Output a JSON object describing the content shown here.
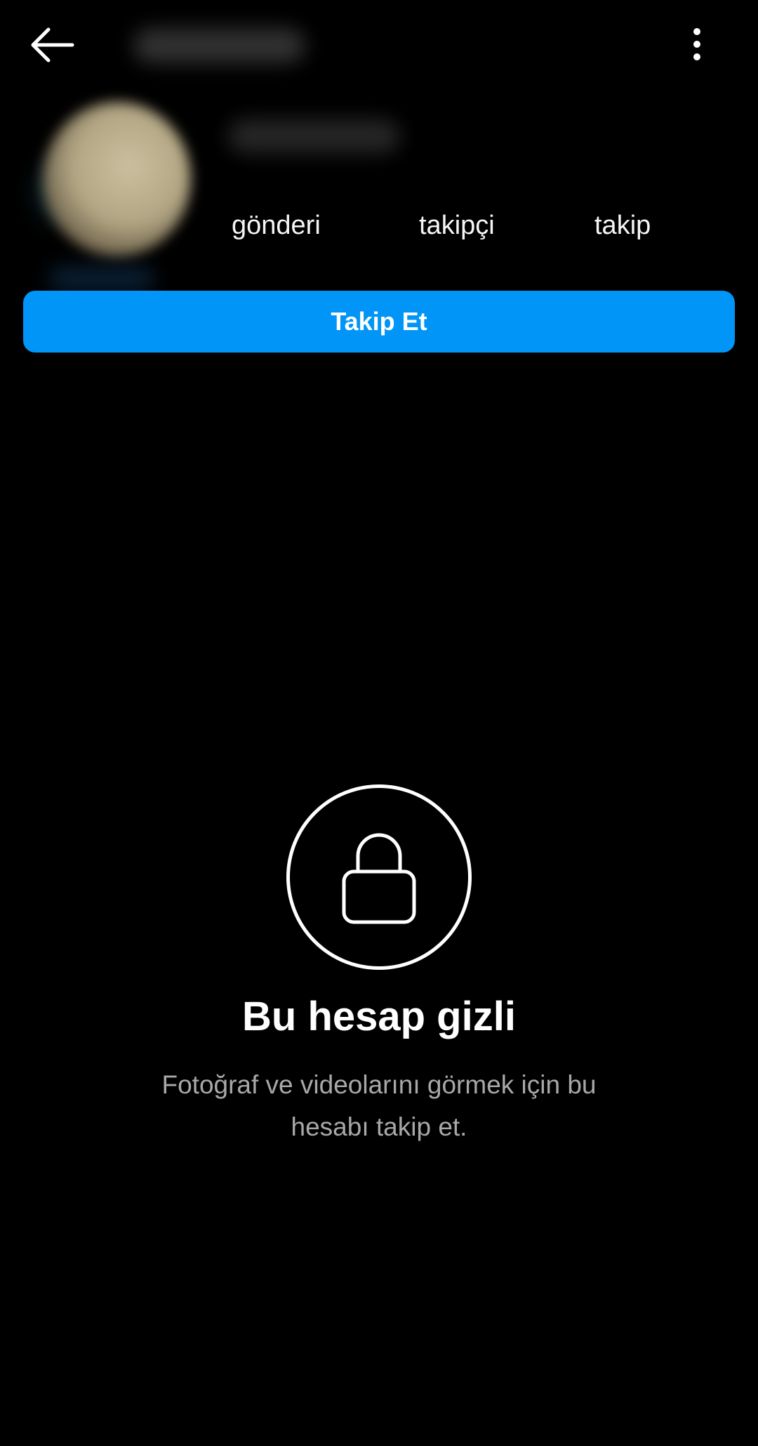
{
  "top_bar": {
    "back_icon": "arrow-left-icon",
    "more_icon": "vertical-dots-icon"
  },
  "profile": {
    "stats": {
      "posts_label": "gönderi",
      "followers_label": "takipçi",
      "following_label": "takip"
    },
    "follow_button_label": "Takip Et",
    "follow_button_color": "#0095f6"
  },
  "private_notice": {
    "icon": "lock-icon",
    "title": "Bu hesap gizli",
    "description": "Fotoğraf ve videolarını görmek için bu hesabı takip et."
  },
  "colors": {
    "background": "#000000",
    "text_primary": "#ffffff",
    "text_secondary": "#a8a8a8"
  }
}
